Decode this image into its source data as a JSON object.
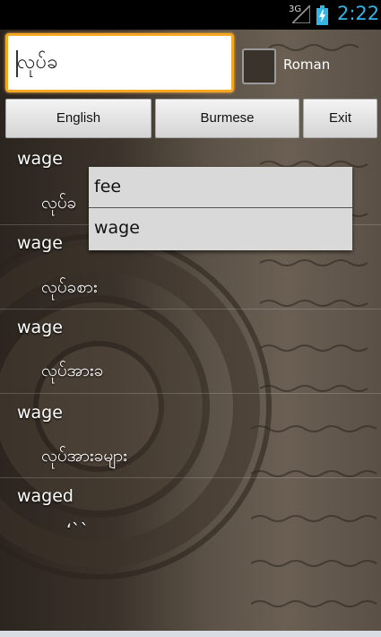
{
  "status": {
    "network": "3G",
    "time": "2:22"
  },
  "search": {
    "value": "လုပ်ခ"
  },
  "roman_checkbox": {
    "label": "Roman",
    "checked": false
  },
  "buttons": {
    "english": "English",
    "burmese": "Burmese",
    "exit": "Exit"
  },
  "results": [
    {
      "word": "wage",
      "translation": "လုပ်ခ"
    },
    {
      "word": "wage",
      "translation": "လုပ်ခစား"
    },
    {
      "word": "wage",
      "translation": "လုပ်အားခ"
    },
    {
      "word": "wage",
      "translation": "လုပ်အားခများ"
    },
    {
      "word": "waged",
      "translation": "ʻ``"
    }
  ],
  "suggestions": [
    "fee",
    "wage"
  ],
  "colors": {
    "accent": "#33b5e5",
    "focus_border": "#f5a623"
  }
}
